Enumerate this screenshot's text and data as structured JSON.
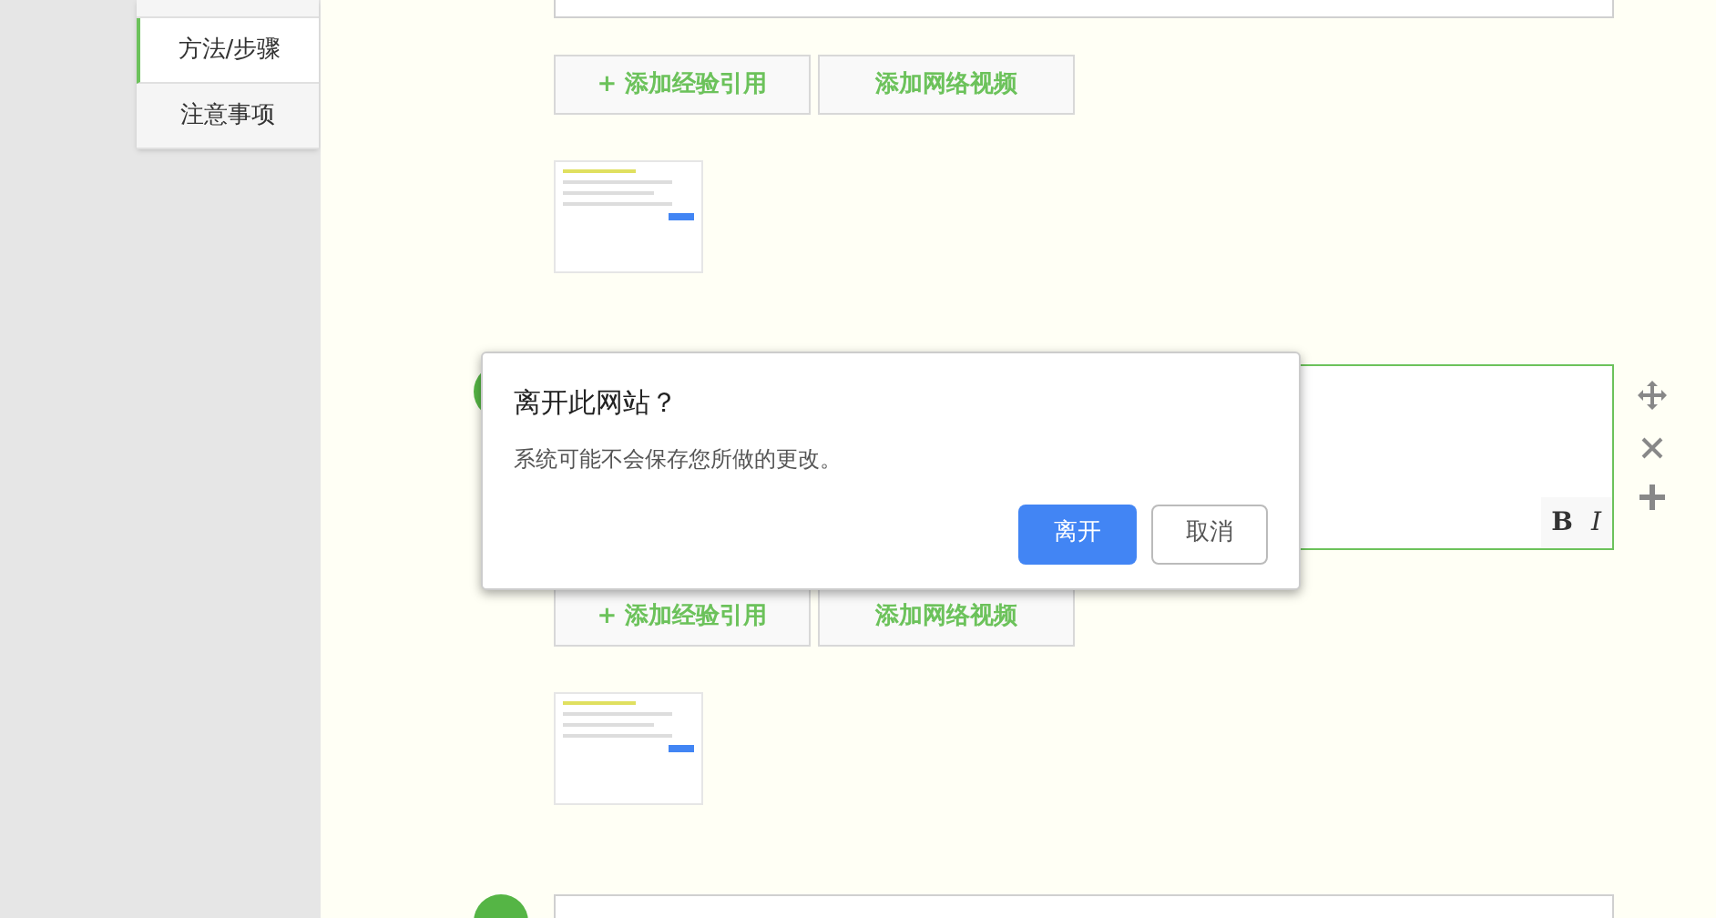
{
  "sidebar": {
    "items": [
      {
        "label": "方法/步骤",
        "selected": true
      },
      {
        "label": "注意事项",
        "selected": false
      }
    ]
  },
  "steps": [
    {
      "buttons": [
        "+ 添加经验引用",
        "添加网络视频"
      ]
    },
    {
      "focused": true,
      "toolbar": [
        "B",
        "I"
      ],
      "buttons": [
        "+ 添加经验引用",
        "添加网络视频"
      ]
    }
  ],
  "dialog": {
    "title": "离开此网站？",
    "message": "系统可能不会保存您所做的更改。",
    "buttons": [
      {
        "label": "离开",
        "primary": true
      },
      {
        "label": "取消",
        "primary": false
      }
    ]
  }
}
